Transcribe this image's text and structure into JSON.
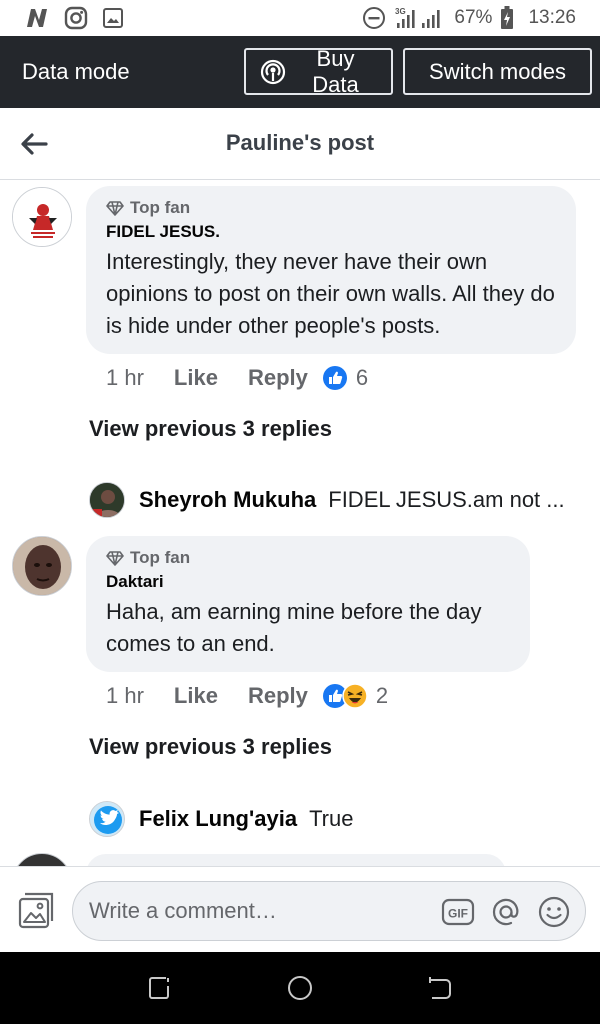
{
  "status_bar": {
    "battery": "67%",
    "time": "13:26",
    "network": "3G",
    "icons": [
      "n-icon",
      "instagram-icon",
      "gallery-icon",
      "dnd-icon",
      "signal-icon",
      "battery-icon"
    ]
  },
  "data_mode": {
    "title": "Data mode",
    "buy_label": "Buy Data",
    "switch_label": "Switch modes"
  },
  "header": {
    "title": "Pauline's post"
  },
  "comments": [
    {
      "badge": "Top fan",
      "author": "FIDEL JESUS.",
      "text": "Interestingly, they never have their own opinions to post on their own walls. All they do is hide under other people's posts.",
      "time": "1 hr",
      "like": "Like",
      "reply": "Reply",
      "reaction_count": "6",
      "view_replies": "View previous 3 replies",
      "latest_reply": {
        "name": "Sheyroh Mukuha",
        "text": "FIDEL JESUS.am not ..."
      }
    },
    {
      "badge": "Top fan",
      "author": "Daktari",
      "text": "Haha, am earning mine before the day comes to an end.",
      "time": "1 hr",
      "like": "Like",
      "reply": "Reply",
      "reaction_count": "2",
      "view_replies": "View previous 3 replies",
      "latest_reply": {
        "name": "Felix Lung'ayia",
        "text": "True"
      }
    }
  ],
  "composer": {
    "placeholder": "Write a comment…"
  },
  "colors": {
    "accent": "#1877f2",
    "data_bar": "#24272c",
    "bubble": "#f0f2f5"
  }
}
